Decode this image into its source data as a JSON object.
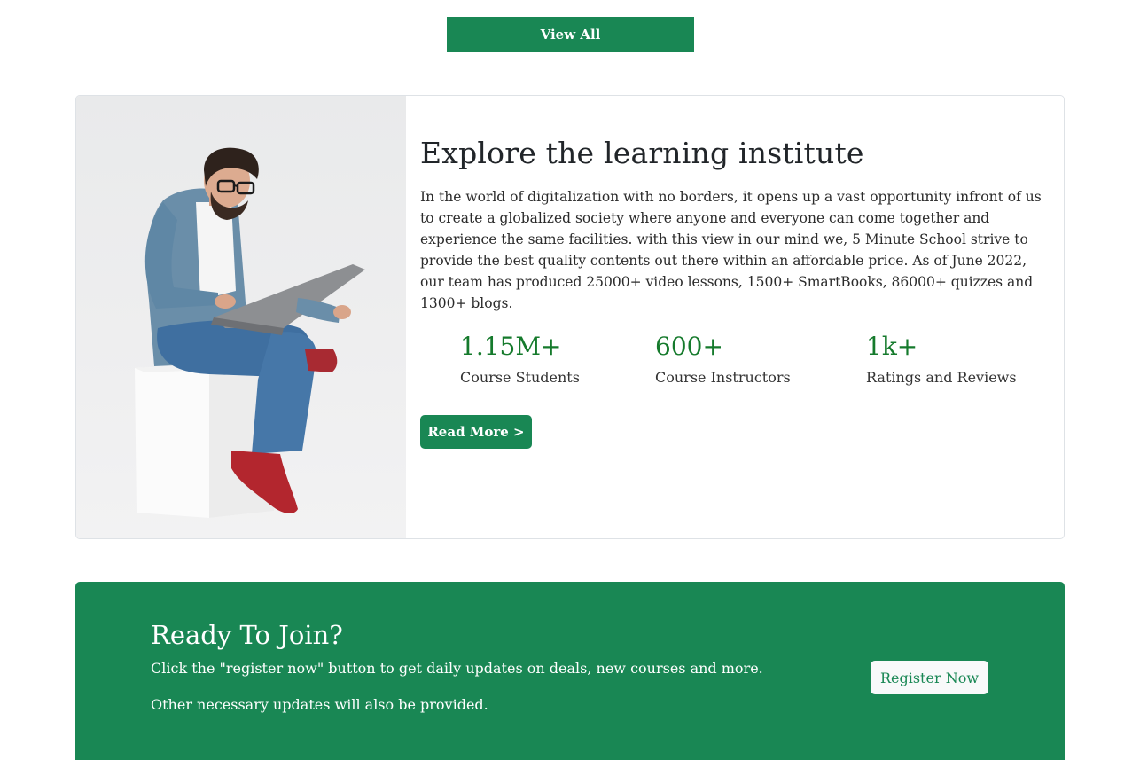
{
  "top": {
    "view_all_label": "View All"
  },
  "about": {
    "title": "Explore the learning institute",
    "body": "In the world of digitalization with no borders, it opens up a vast opportunity infront of us to create a globalized society where anyone and everyone can come together and experience the same facilities. with this view in our mind we, 5 Minute School strive to provide the best quality contents out there within an affordable price. As of June 2022, our team has produced 25000+ video lessons, 1500+ SmartBooks, 86000+ quizzes and 1300+ blogs.",
    "stats": [
      {
        "value": "1.15M+",
        "label": "Course Students"
      },
      {
        "value": "600+",
        "label": "Course Instructors"
      },
      {
        "value": "1k+",
        "label": "Ratings and Reviews"
      }
    ],
    "read_more_label": "Read More >",
    "image": "man-with-laptop-photo"
  },
  "join": {
    "title": "Ready To Join?",
    "line1": "Click the \"register now\" button to get daily updates on deals, new courses and more.",
    "line2": "Other necessary updates will also be provided.",
    "register_label": "Register Now"
  },
  "colors": {
    "primary": "#198754",
    "stat_text": "#157a2c",
    "button_light": "#f8f9fa"
  }
}
